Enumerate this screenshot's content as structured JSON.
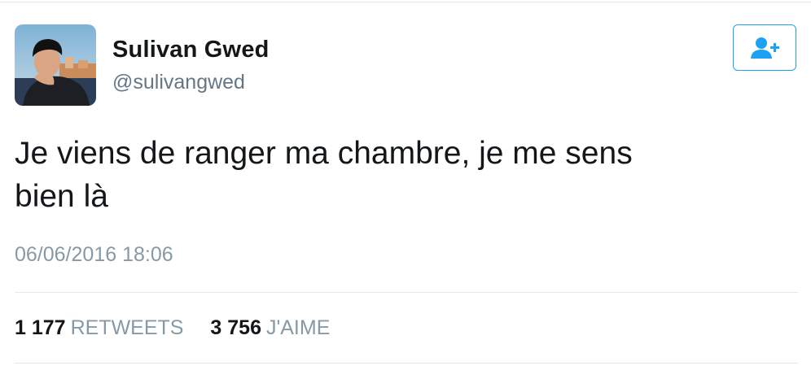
{
  "tweet": {
    "author": {
      "display_name": "Sulivan Gwed",
      "handle": "@sulivangwed",
      "avatar_icon": "profile-photo"
    },
    "follow_button": {
      "icon": "follow-user-plus-icon",
      "color": "#1da1f2"
    },
    "text_line_1": "Je viens de ranger ma chambre, je me sens",
    "text_line_2": "bien là",
    "timestamp": "06/06/2016 18:06",
    "stats": {
      "retweets_count": "1 177",
      "retweets_label": "RETWEETS",
      "likes_count": "3 756",
      "likes_label": "J'AIME"
    }
  }
}
